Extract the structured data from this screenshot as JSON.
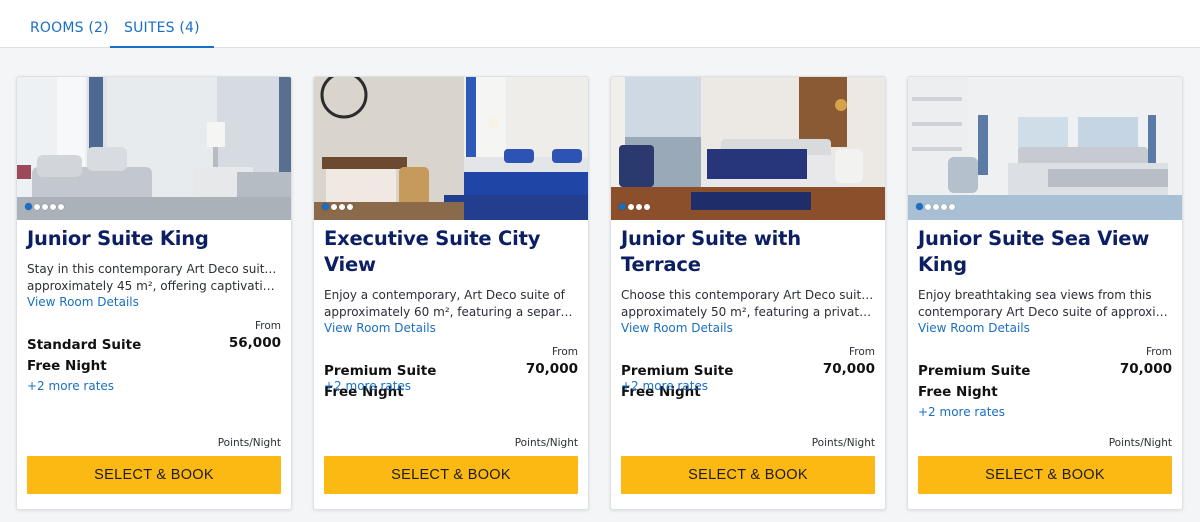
{
  "tabs": [
    {
      "label": "ROOMS (2)"
    },
    {
      "label": "SUITES (4)"
    }
  ],
  "cards": [
    {
      "title": "Junior Suite King",
      "desc_line1": "Stay in this contemporary Art Deco suite of",
      "desc_line2": "approximately 45 m², offering captivating cit...",
      "details_link": "View Room Details",
      "from_label": "From",
      "rate_name": "Standard Suite Free Night",
      "price": "56,000",
      "more_rates": "+2 more rates",
      "points_label": "Points/Night",
      "button": "SELECT & BOOK"
    },
    {
      "title": "Executive Suite City View",
      "desc_line1": "Enjoy a contemporary, Art Deco suite of",
      "desc_line2": "approximately 60 m², featuring a separate...",
      "details_link": "View Room Details",
      "from_label": "From",
      "rate_name": "Premium Suite Free Night",
      "price": "70,000",
      "more_rates": "+2 more rates",
      "points_label": "Points/Night",
      "button": "SELECT & BOOK"
    },
    {
      "title": "Junior Suite with Terrace",
      "desc_line1": "Choose this contemporary Art Deco suite of",
      "desc_line2": "approximately 50 m², featuring a private...",
      "details_link": "View Room Details",
      "from_label": "From",
      "rate_name": "Premium Suite Free Night",
      "price": "70,000",
      "more_rates": "+2 more rates",
      "points_label": "Points/Night",
      "button": "SELECT & BOOK"
    },
    {
      "title": "Junior Suite Sea View King",
      "desc_line1": "Enjoy breathtaking sea views from this",
      "desc_line2": "contemporary Art Deco suite of approximatel...",
      "details_link": "View Room Details",
      "from_label": "From",
      "rate_name": "Premium Suite Free Night",
      "price": "70,000",
      "more_rates": "+2 more rates",
      "points_label": "Points/Night",
      "button": "SELECT & BOOK"
    }
  ],
  "colors": {
    "accent": "#1a6fc4",
    "title": "#0c1f63",
    "button": "#fdb913"
  }
}
